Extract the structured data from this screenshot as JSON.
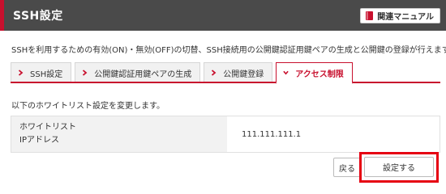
{
  "header": {
    "title": "SSH設定",
    "manual_label": "関連マニュアル"
  },
  "description": "SSHを利用するための有効(ON)・無効(OFF)の切替、SSH接続用の公開鍵認証用鍵ペアの生成と公開鍵の登録が行えます。",
  "tabs": [
    {
      "label": "SSH設定",
      "active": false
    },
    {
      "label": "公開鍵認証用鍵ペアの生成",
      "active": false
    },
    {
      "label": "公開鍵登録",
      "active": false
    },
    {
      "label": "アクセス制限",
      "active": true
    }
  ],
  "form": {
    "intro": "以下のホワイトリスト設定を変更します。",
    "label_line1": "ホワイトリスト",
    "label_line2": "IPアドレス",
    "value": "111.111.111.1"
  },
  "buttons": {
    "back_label": "戻る",
    "submit_label": "設定する"
  },
  "colors": {
    "accent": "#c8102e",
    "header_bg": "#4a4a4a",
    "highlight": "#e60012"
  },
  "icons": {
    "manual": "book-icon",
    "tab": "chevron-right-icon",
    "active_tab": "chevron-down-icon"
  }
}
